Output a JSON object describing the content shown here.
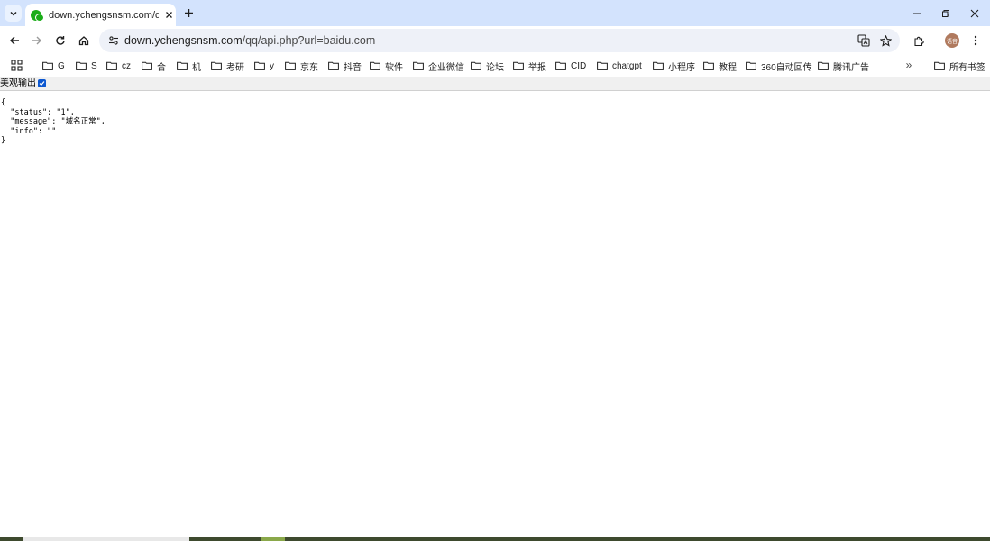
{
  "browser": {
    "tab": {
      "title": "down.ychengsnsm.com/qq/api.php?url=baidu.com",
      "favicon": "wechat-icon"
    },
    "address": {
      "host": "down.ychengsnsm.com",
      "path": "/qq/api.php?url=baidu.com"
    },
    "avatar_text": "语音",
    "accent_color": "#d3e3fd"
  },
  "bookmarks": {
    "items": [
      "G",
      "S",
      "cz",
      "合",
      "机",
      "考研",
      "y",
      "京东",
      "抖音",
      "软件",
      "企业微信",
      "论坛",
      "举报",
      "CID",
      "chatgpt",
      "小程序",
      "教程",
      "360自动回传",
      "腾讯广告"
    ],
    "all_bookmarks": "所有书签"
  },
  "page": {
    "pretty_print_label": "美观输出",
    "pretty_print_checked": true,
    "json_lines": [
      "{",
      "  \"status\": \"1\",",
      "  \"message\": \"域名正常\",",
      "  \"info\": \"\"",
      "}"
    ]
  }
}
